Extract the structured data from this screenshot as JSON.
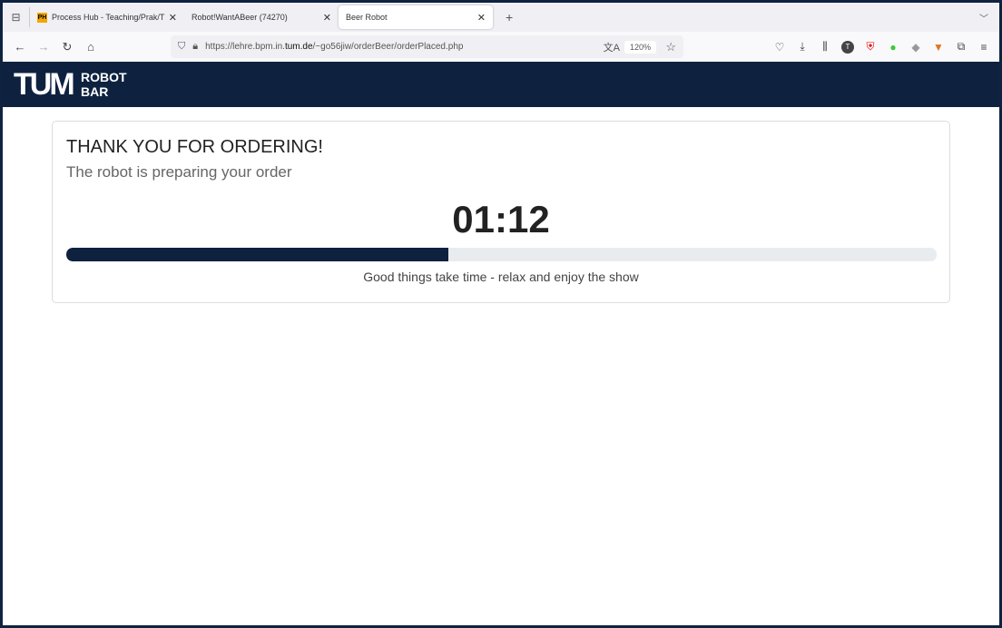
{
  "browser": {
    "tabs": [
      {
        "label": "Process Hub - Teaching/Prak/T",
        "favicon": "PH"
      },
      {
        "label": "Robot!WantABeer (74270)"
      },
      {
        "label": "Beer Robot",
        "active": true
      }
    ],
    "url_prefix": "https://lehre.bpm.in.",
    "url_domain": "tum.de",
    "url_suffix": "/~go56jiw/orderBeer/orderPlaced.php",
    "zoom": "120%"
  },
  "header": {
    "logo": "TUM",
    "brand_line1": "ROBOT",
    "brand_line2": "BAR"
  },
  "order": {
    "title": "THANK YOU FOR ORDERING!",
    "subtitle": "The robot is preparing your order",
    "timer": "01:12",
    "progress_percent": 43.9,
    "caption": "Good things take time - relax and enjoy the show"
  },
  "colors": {
    "brand": "#0e2240",
    "track": "#e9ecef"
  }
}
